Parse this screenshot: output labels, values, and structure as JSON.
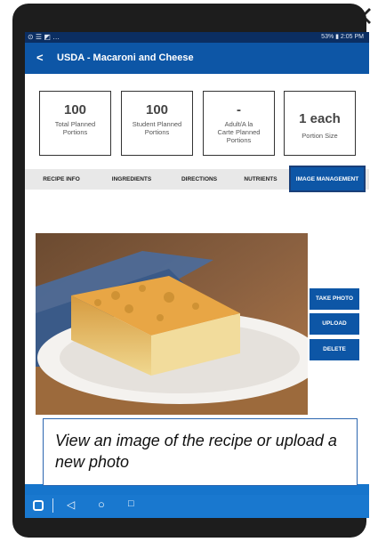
{
  "window_icons": {
    "popout_icon": "popout-icon",
    "close_icon": "close-icon"
  },
  "status_bar": {
    "right_text": "53% ▮ 2:05 PM"
  },
  "app_bar": {
    "back_glyph": "<",
    "title": "USDA - Macaroni and Cheese"
  },
  "summary_cards": [
    {
      "value": "100",
      "label": "Total Planned Portions"
    },
    {
      "value": "100",
      "label": "Student Planned Portions"
    },
    {
      "value": "-",
      "label": "Adult/A la Carte Planned Portions"
    },
    {
      "value": "1 each",
      "label": "Portion Size"
    }
  ],
  "tabs": [
    {
      "label": "RECIPE INFO"
    },
    {
      "label": "INGREDIENTS"
    },
    {
      "label": "DIRECTIONS"
    },
    {
      "label": "NUTRIENTS"
    },
    {
      "label": "IMAGE MANAGEMENT"
    }
  ],
  "active_tab": "IMAGE MANAGEMENT",
  "actions": {
    "take_photo": "TAKE PHOTO",
    "upload": "UPLOAD",
    "delete": "DELETE"
  },
  "callout_text": "View an image of the recipe or upload a new photo",
  "colors": {
    "primary": "#0d56a6",
    "status_bar": "#0b2e62",
    "nav_bar": "#1675cc"
  }
}
